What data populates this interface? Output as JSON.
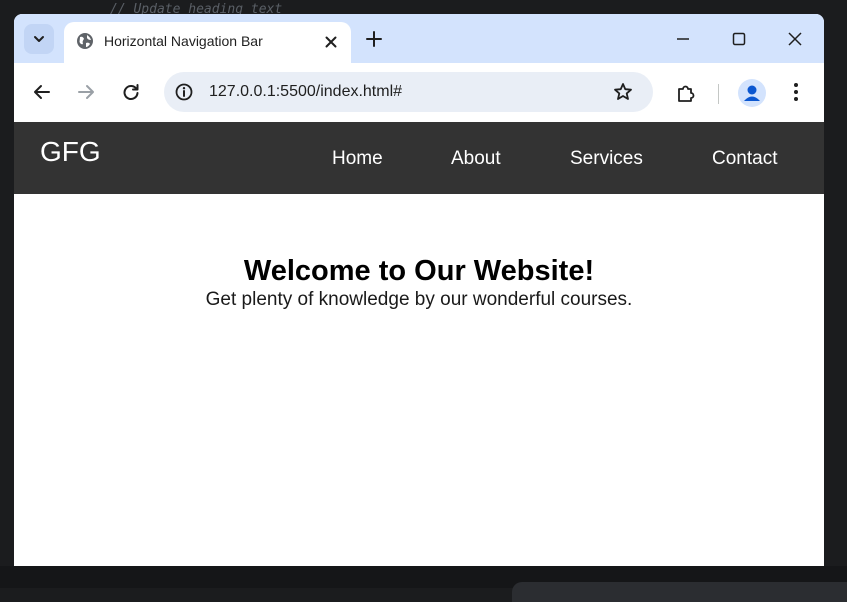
{
  "background": {
    "code_fragment": "// Update heading text"
  },
  "browser": {
    "tab": {
      "title": "Horizontal Navigation Bar",
      "favicon": "globe-icon"
    },
    "tab_search_icon": "chevron-down-icon",
    "new_tab_icon": "plus-icon",
    "window_controls": [
      "minimize-icon",
      "maximize-icon",
      "close-icon"
    ],
    "toolbar": {
      "back_icon": "arrow-left-icon",
      "forward_icon": "arrow-right-icon",
      "reload_icon": "reload-icon",
      "url": "127.0.0.1:5500/index.html#",
      "site_info_icon": "info-icon",
      "bookmark_icon": "star-icon",
      "extensions_icon": "puzzle-icon",
      "profile_icon": "avatar-icon",
      "menu_icon": "more-vert-icon"
    }
  },
  "page": {
    "logo": "GFG",
    "nav": [
      {
        "label": "Home"
      },
      {
        "label": "About"
      },
      {
        "label": "Services"
      },
      {
        "label": "Contact"
      }
    ],
    "heading": "Welcome to Our Website!",
    "subheading": "Get plenty of knowledge by our wonderful courses."
  },
  "colors": {
    "navbar_bg": "#333333",
    "nav_text": "#ffffff",
    "tabbar_bg": "#d3e3fd",
    "omnibox_bg": "#e9eef6",
    "profile_accent": "#0b57d0"
  }
}
